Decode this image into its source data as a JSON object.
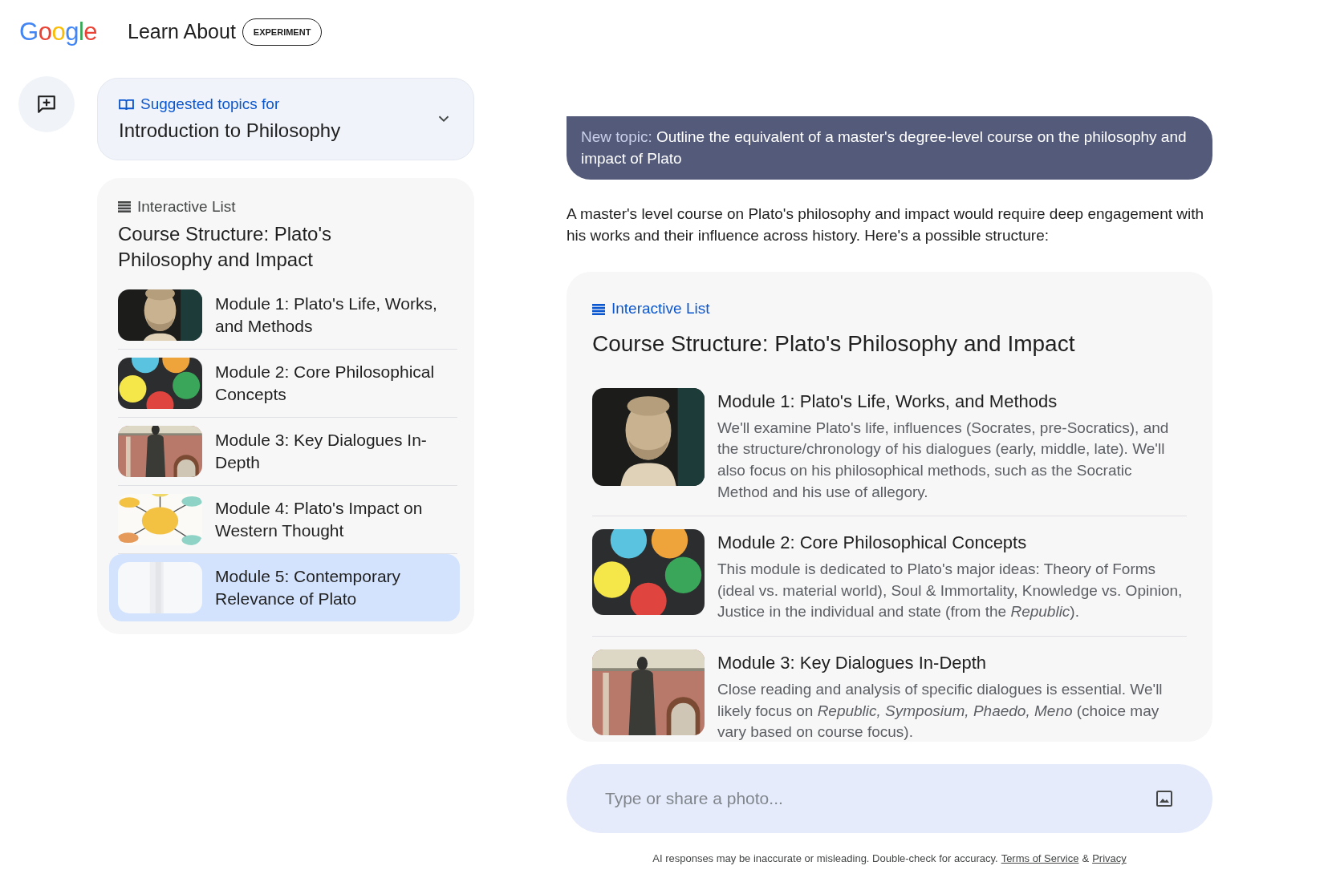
{
  "header": {
    "logo": "Google",
    "title": "Learn About",
    "badge": "EXPERIMENT"
  },
  "suggested": {
    "label": "Suggested topics for",
    "topic": "Introduction to Philosophy",
    "expanded": false
  },
  "sidebar_list": {
    "label": "Interactive List",
    "title": "Course Structure: Plato's Philosophy and Impact",
    "items": [
      {
        "title": "Module 1: Plato's Life, Works, and Methods",
        "selected": false
      },
      {
        "title": "Module 2: Core Philosophical Concepts",
        "selected": false
      },
      {
        "title": "Module 3: Key Dialogues In-Depth",
        "selected": false
      },
      {
        "title": "Module 4: Plato's Impact on Western Thought",
        "selected": false
      },
      {
        "title": "Module 5: Contemporary Relevance of Plato",
        "selected": true
      }
    ]
  },
  "prompt": {
    "label": "New topic:",
    "text": "Outline the equivalent of a master's degree-level course on the philosophy and impact of Plato"
  },
  "answer": "A master's level course on Plato's philosophy and impact would require deep engagement with his works and their influence across history. Here's a possible structure:",
  "list_card": {
    "label": "Interactive List",
    "title": "Course Structure: Plato's Philosophy and Impact",
    "items": [
      {
        "title": "Module 1: Plato's Life, Works, and Methods",
        "description": "We'll examine Plato's life, influences (Socrates, pre-Socratics), and the structure/chronology of his dialogues (early, middle, late). We'll also focus on his philosophical methods, such as the Socratic Method and his use of allegory."
      },
      {
        "title": "Module 2: Core Philosophical Concepts",
        "description": "This module is dedicated to Plato's major ideas: Theory of Forms (ideal vs. material world), Soul & Immortality, Knowledge vs. Opinion, Justice in the individual and state (from the *Republic*)."
      },
      {
        "title": "Module 3: Key Dialogues In-Depth",
        "description": "Close reading and analysis of specific dialogues is essential. We'll likely focus on *Republic, Symposium, Phaedo, Meno* (choice may vary based on course focus)."
      }
    ]
  },
  "input": {
    "placeholder": "Type or share a photo..."
  },
  "footer": {
    "disclaimer": "AI responses may be inaccurate or misleading. Double-check for accuracy.",
    "links": [
      "Terms of Service",
      "Privacy"
    ],
    "separator": "&"
  }
}
